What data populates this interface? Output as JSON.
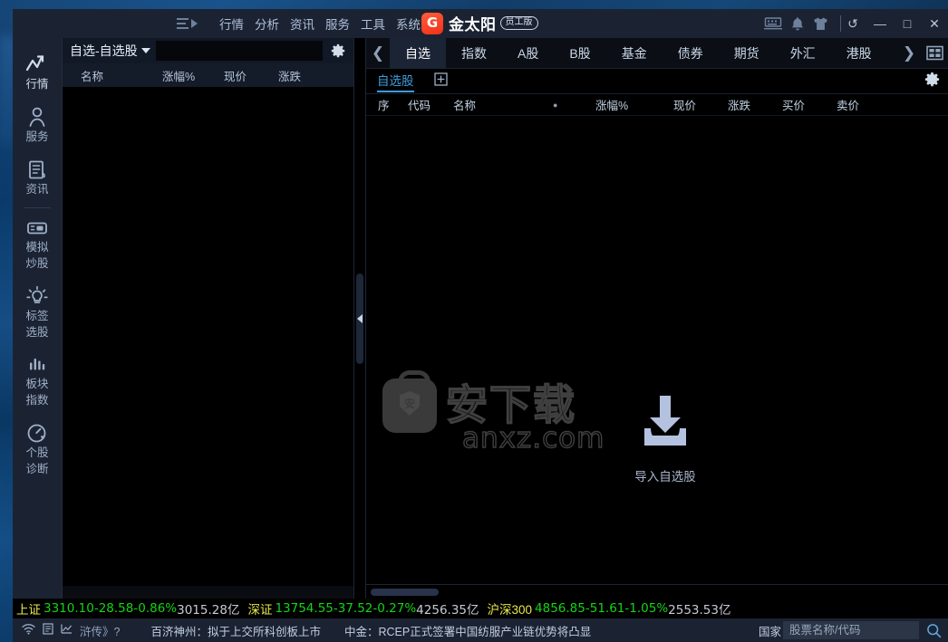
{
  "window": {
    "logo_text": "金太阳",
    "logo_badge": "员工版",
    "logo_glyph": "G",
    "nav": [
      "行情",
      "分析",
      "资讯",
      "服务",
      "工具",
      "系统"
    ],
    "tray_icons": [
      "keyboard-icon",
      "bell-icon",
      "shirt-icon"
    ],
    "controls": {
      "restore": "↺",
      "minimize": "—",
      "maximize": "□",
      "close": "✕"
    }
  },
  "rail": {
    "items": [
      {
        "label": "行情",
        "icon": "chart-line-icon",
        "active": true
      },
      {
        "label": "服务",
        "icon": "user-icon",
        "active": false
      },
      {
        "label": "资讯",
        "icon": "news-doc-icon",
        "active": false
      },
      {
        "label": "模拟\n炒股",
        "icon": "trade-sim-icon",
        "active": false
      },
      {
        "label": "标签\n选股",
        "icon": "bulb-icon",
        "active": false
      },
      {
        "label": "板块\n指数",
        "icon": "bar-chart-icon",
        "active": false
      },
      {
        "label": "个股\n诊断",
        "icon": "gauge-icon",
        "active": false
      }
    ],
    "labels": {
      "hangqing": "行情",
      "fuwu": "服务",
      "zixun": "资讯",
      "moni1": "模拟",
      "moni2": "炒股",
      "biaoqian1": "标签",
      "biaoqian2": "选股",
      "bankuai1": "板块",
      "bankuai2": "指数",
      "gegu1": "个股",
      "gegu2": "诊断"
    }
  },
  "left_panel": {
    "title": "自选-自选股",
    "search_placeholder": "",
    "search_value": "",
    "gear": "gear-icon",
    "columns": [
      "名称",
      "涨幅%",
      "现价",
      "涨跌"
    ],
    "rows": []
  },
  "main": {
    "tabs": [
      "自选",
      "指数",
      "A股",
      "B股",
      "基金",
      "债券",
      "期货",
      "外汇",
      "港股"
    ],
    "active_tab": "自选",
    "prev_arrow": "❮",
    "next_arrow": "❯",
    "layout_icon": "grid-layout-icon",
    "subtabs": [
      "自选股"
    ],
    "add_subtab": "add-tab-icon",
    "settings": "gear-icon",
    "columns": [
      "序",
      "代码",
      "名称",
      "●",
      "涨幅%",
      "现价",
      "涨跌",
      "买价",
      "卖价"
    ],
    "rows": [],
    "empty_action": {
      "label": "导入自选股",
      "icon": "download-import-icon"
    },
    "watermark": {
      "cn": "安下载",
      "en": "anxz.com",
      "shield_char": "安"
    }
  },
  "index_bar": {
    "items": [
      {
        "name": "上证",
        "value": "3310.10",
        "change": "-28.58",
        "percent": "-0.86%",
        "amount": "3015.28亿"
      },
      {
        "name": "深证",
        "value": "13754.55",
        "change": "-37.52",
        "percent": "-0.27%",
        "amount": "4256.35亿"
      },
      {
        "name": "沪深300",
        "value": "4856.85",
        "change": "-51.61",
        "percent": "-1.05%",
        "amount": "2553.53亿"
      }
    ],
    "down_color": "#15d515",
    "name_color": "#e8e84a",
    "amount_color": "#c9c9d8"
  },
  "bottom_bar": {
    "icons": [
      "wifi-icon",
      "list-icon",
      "chart-icon"
    ],
    "mini_text": "浒传》?",
    "news": [
      "百济神州：拟于上交所科创板上市",
      "中金：RCEP正式签署中国纺服产业链优势将凸显"
    ],
    "clip_text": "国家",
    "search_placeholder": "股票名称/代码",
    "search_value": "",
    "search_icon": "search-icon"
  }
}
